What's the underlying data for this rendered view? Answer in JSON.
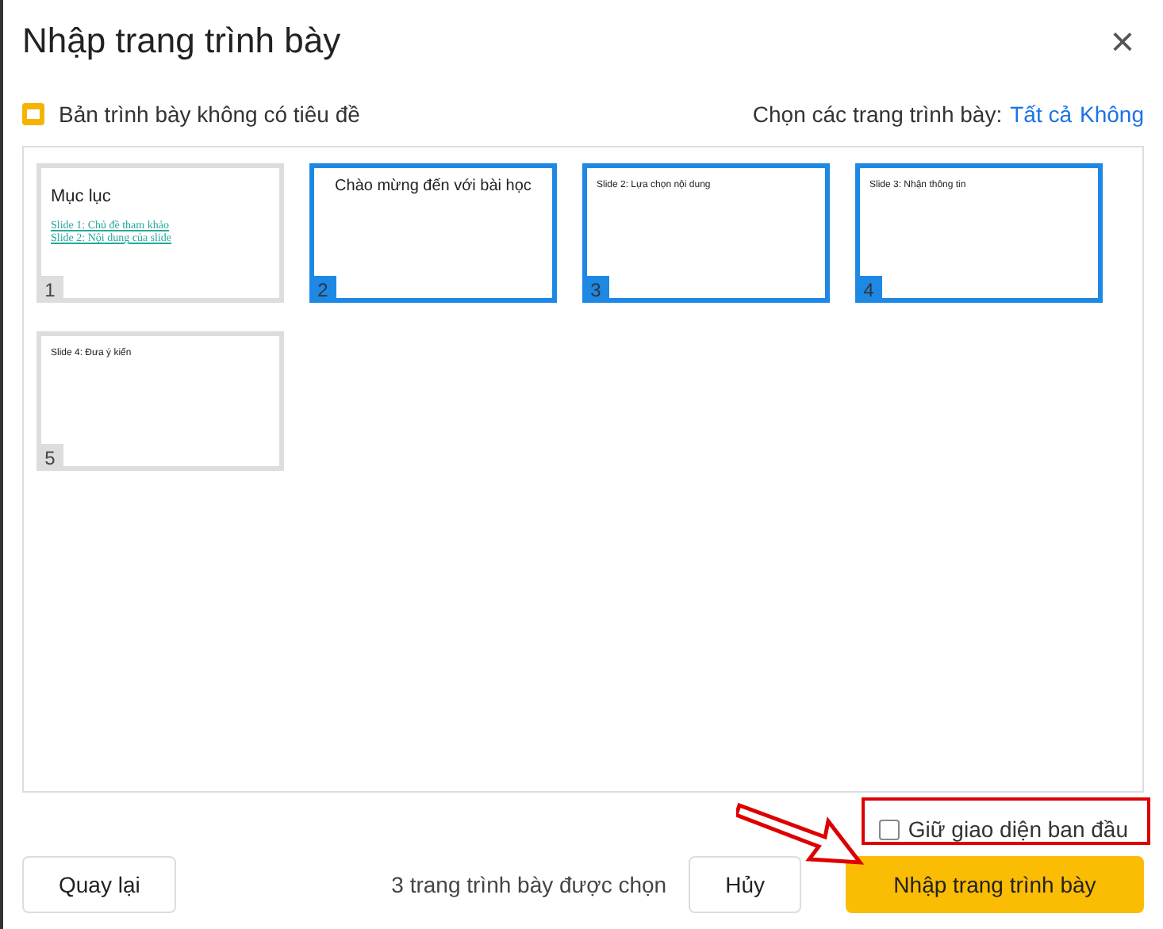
{
  "dialog": {
    "title": "Nhập trang trình bày",
    "close": "×"
  },
  "presentation": {
    "name": "Bản trình bày không có tiêu đề",
    "select_label": "Chọn các trang trình bày:",
    "select_all": "Tất cả",
    "select_none": "Không"
  },
  "slides": [
    {
      "number": "1",
      "selected": false,
      "kind": "toc",
      "heading": "Mục lục",
      "links": [
        "Slide 1: Chủ đề tham khảo",
        "Slide 2: Nội dung của slide"
      ]
    },
    {
      "number": "2",
      "selected": true,
      "kind": "title",
      "heading": "Chào mừng đến với bài học"
    },
    {
      "number": "3",
      "selected": true,
      "kind": "body",
      "heading": "Slide 2: Lựa chọn nội dung"
    },
    {
      "number": "4",
      "selected": true,
      "kind": "body",
      "heading": "Slide 3: Nhận thông tin"
    },
    {
      "number": "5",
      "selected": false,
      "kind": "body",
      "heading": "Slide 4: Đưa ý kiến"
    }
  ],
  "keep_theme": {
    "label": "Giữ giao diện ban đầu",
    "checked": false
  },
  "footer": {
    "back": "Quay lại",
    "count": "3 trang trình bày được chọn",
    "cancel": "Hủy",
    "import": "Nhập trang trình bày"
  }
}
